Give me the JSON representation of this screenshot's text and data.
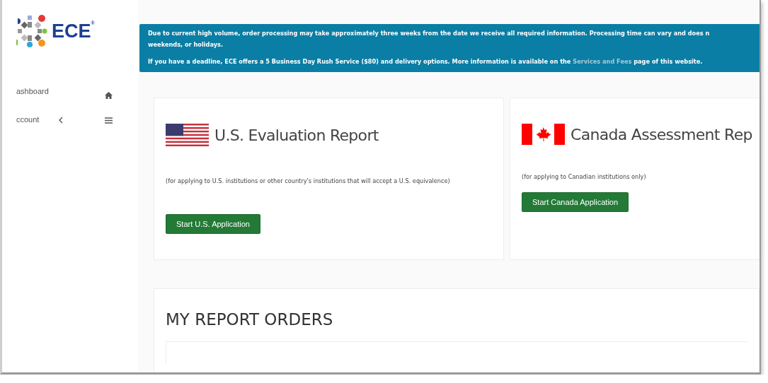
{
  "logo": {
    "text": "ECE",
    "mark": "®"
  },
  "sidebar": {
    "items": [
      {
        "kind": "link",
        "label": "ashboard"
      },
      {
        "kind": "menu",
        "label": "ccount",
        "expanded": false
      }
    ]
  },
  "notice": {
    "lines": [
      "Due to current high volume, order processing may take approximately three weeks from the date we receive all required information. Processing time can vary and does n",
      "weekends, or holidays."
    ],
    "deadline": {
      "before": "If you have a deadline, ECE offers a 5 Business Day Rush Service ($80) and delivery options. More information is available on the",
      "link": "Services and Fees",
      "after": "page of this website."
    }
  },
  "cards": [
    {
      "kind": "us",
      "title": "U.S. Evaluation Report",
      "description": "(for applying to U.S. institutions or other country's institutions that will accept a U.S. equivalence)",
      "button": "Start U.S. Application"
    },
    {
      "kind": "canada",
      "title": "Canada Assessment Rep",
      "description": "(for applying to Canadian institutions only)",
      "button": "Start Canada Application"
    }
  ],
  "orders": {
    "title": "MY REPORT ORDERS"
  }
}
